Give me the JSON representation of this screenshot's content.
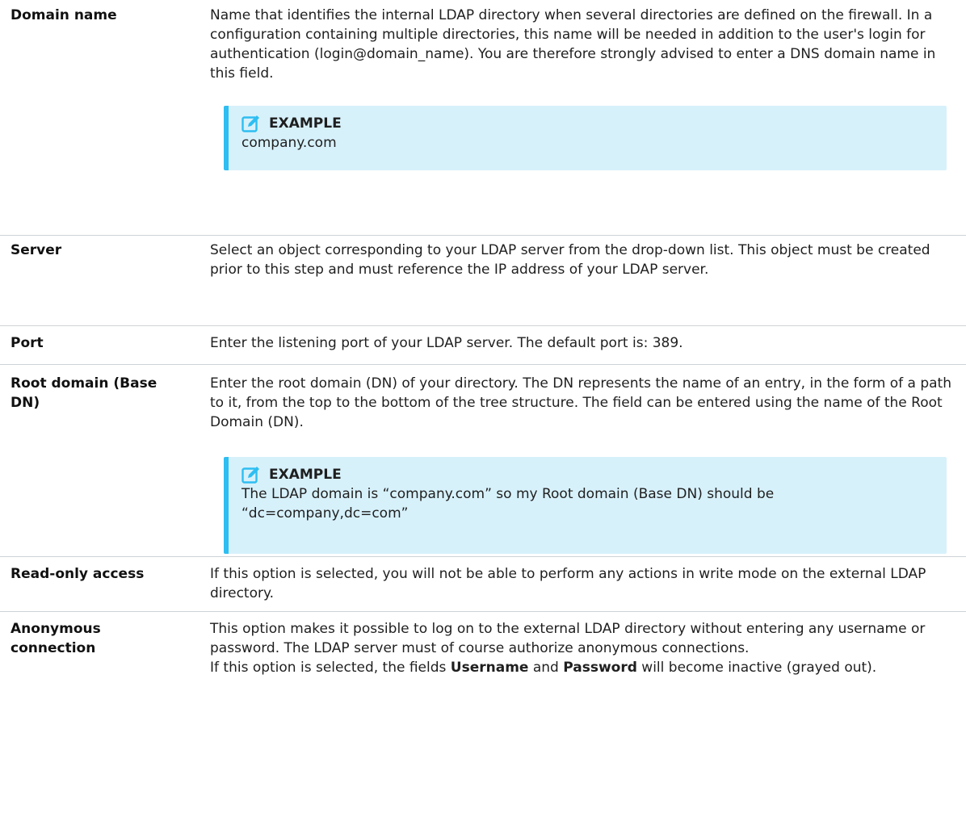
{
  "rows": [
    {
      "term": "Domain name",
      "desc": "Name that identifies the internal LDAP directory when several directories are defined on the firewall. In a configuration containing multiple directories, this name will be needed in addition to the user's login for authentication (login@domain_name). You are therefore strongly advised to enter a DNS domain name in this field.",
      "example_title": "EXAMPLE",
      "example_text": "company.com"
    },
    {
      "term": "Server",
      "desc": "Select an object corresponding to your LDAP server from the drop-down list. This object must be created prior to this step and must reference the IP address of your LDAP server."
    },
    {
      "term": "Port",
      "desc": "Enter the listening port of your LDAP server. The default port is: 389."
    },
    {
      "term": "Root domain (Base DN)",
      "desc": "Enter the root domain (DN) of your directory. The DN represents the name of an entry, in the form of a path to it, from the top to the bottom of the tree structure. The field can be entered using the name of the Root Domain (DN).",
      "example_title": "EXAMPLE",
      "example_text": "The LDAP domain is “company.com” so my Root domain (Base DN) should be “dc=company,dc=com”"
    },
    {
      "term": "Read-only access",
      "desc": "If this option is selected, you will not be able to perform any actions in write mode on the external LDAP directory."
    },
    {
      "term": "Anonymous connection",
      "desc": "This option makes it possible to log on to the external LDAP directory without entering any username or password. The LDAP server must of course authorize anonymous connections.",
      "desc2_before": "If this option is selected, the fields ",
      "desc2_bold1": "Username",
      "desc2_mid": " and ",
      "desc2_bold2": "Password",
      "desc2_after": " will become inactive (grayed out)."
    }
  ],
  "colors": {
    "example_bg": "#d7f1fb",
    "example_border": "#2ebef1",
    "icon": "#2ebef1",
    "divider": "#cfd3d6"
  }
}
